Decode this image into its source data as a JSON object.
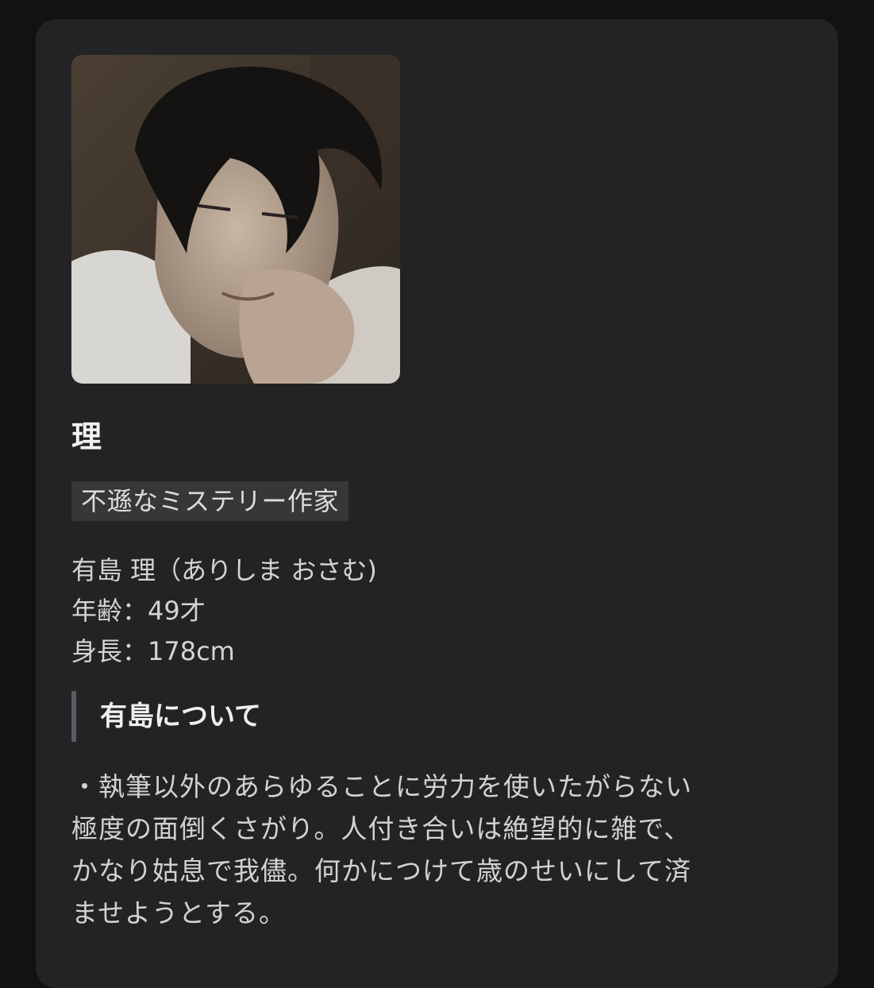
{
  "character": {
    "name": "理",
    "tagline": "不遜なミステリー作家",
    "profile": [
      "有島 理（ありしま おさむ)",
      "年齢：49才",
      "身長：178cm"
    ],
    "section": {
      "title": "有島について",
      "body_lines": [
        "・執筆以外のあらゆることに労力を使いたがらない",
        "極度の面倒くさがり。人付き合いは絶望的に雑で、",
        "かなり姑息で我儘。何かにつけて歳のせいにして済",
        "ませようとする。"
      ]
    }
  },
  "colors": {
    "background": "#121214",
    "card": "#232326",
    "tag_bg": "#37373a",
    "accent_bar": "#5c5c60",
    "text": "#d4d4d4"
  }
}
